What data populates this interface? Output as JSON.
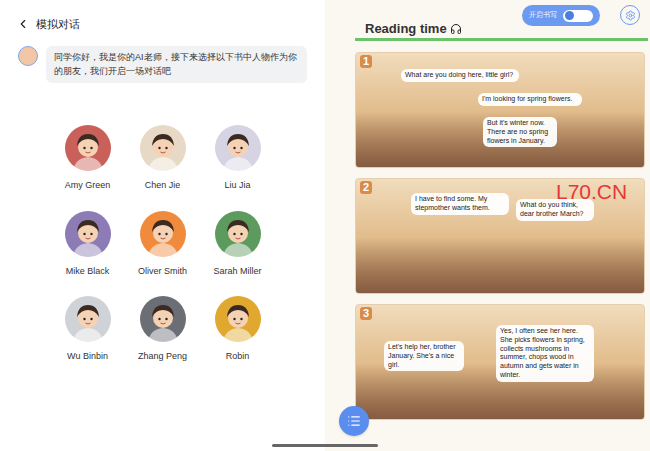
{
  "left_panel": {
    "title": "模拟对话",
    "teacher_message": "同学你好，我是你的AI老师，接下来选择以下书中人物作为你的朋友，我们开启一场对话吧",
    "characters": [
      {
        "name": "Amy Green",
        "color": "#c9605a"
      },
      {
        "name": "Chen Jie",
        "color": "#e8d9c6"
      },
      {
        "name": "Liu Jia",
        "color": "#d6d3e3"
      },
      {
        "name": "Mike Black",
        "color": "#8c7bb5"
      },
      {
        "name": "Oliver Smith",
        "color": "#f08a3c"
      },
      {
        "name": "Sarah Miller",
        "color": "#5d9a5d"
      },
      {
        "name": "Wu Binbin",
        "color": "#cfd3d8"
      },
      {
        "name": "Zhang Peng",
        "color": "#6b6f75"
      },
      {
        "name": "Robin",
        "color": "#e0a82e"
      }
    ]
  },
  "reading": {
    "title": "Reading time",
    "toggle": {
      "label": "开启书写",
      "on": false
    },
    "progress": {
      "level": 1
    },
    "panels": [
      {
        "number": "1",
        "bubbles": [
          "What are you doing here, little girl?",
          "I'm looking for spring flowers.",
          "But it's winter now. There are no spring flowers in January."
        ]
      },
      {
        "number": "2",
        "bubbles": [
          "I have to find some. My stepmother wants them.",
          "What do you think, dear brother March?"
        ]
      },
      {
        "number": "3",
        "bubbles": [
          "Let's help her, brother January. She's a nice girl.",
          "Yes, I often see her here. She picks flowers in spring, collects mushrooms in summer, chops wood in autumn and gets water in winter."
        ]
      }
    ]
  },
  "watermark": "L70.CN"
}
